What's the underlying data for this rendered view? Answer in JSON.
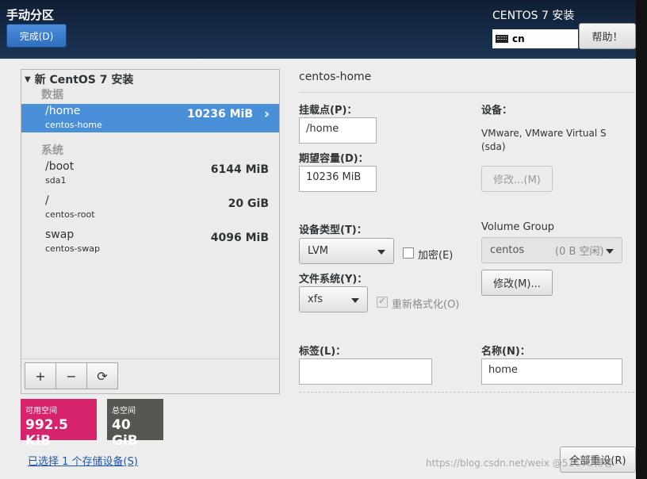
{
  "header": {
    "title": "手动分区",
    "done_label": "完成(D)",
    "product": "CENTOS 7 安装",
    "keyboard_layout": "cn",
    "help_label": "帮助！"
  },
  "tree": {
    "root_label": "新 CentOS 7 安装",
    "sections": [
      {
        "label": "数据",
        "items": [
          {
            "name": "/home",
            "device": "centos-home",
            "size": "10236 MiB",
            "selected": true
          }
        ]
      },
      {
        "label": "系统",
        "items": [
          {
            "name": "/boot",
            "device": "sda1",
            "size": "6144 MiB"
          },
          {
            "name": "/",
            "device": "centos-root",
            "size": "20 GiB"
          },
          {
            "name": "swap",
            "device": "centos-swap",
            "size": "4096 MiB"
          }
        ]
      }
    ],
    "toolbar": {
      "add": "+",
      "remove": "−",
      "refresh": "⟳"
    }
  },
  "space": {
    "available_label": "可用空间",
    "available_value": "992.5 KiB",
    "total_label": "总空间",
    "total_value": "40 GiB"
  },
  "storage_link": "已选择 1 个存储设备(S)",
  "detail": {
    "title": "centos-home",
    "mount_label": "挂载点(P)：",
    "mount_value": "/home",
    "capacity_label": "期望容量(D)：",
    "capacity_value": "10236 MiB",
    "device_label": "设备：",
    "device_info": "VMware, VMware Virtual S (sda)",
    "modify_device_label": "修改...(M)",
    "device_type_label": "设备类型(T)：",
    "device_type_value": "LVM",
    "encrypt_label": "加密(E)",
    "vg_label": "Volume Group",
    "vg_name": "centos",
    "vg_free": "(0 B 空闲)",
    "fs_label": "文件系统(Y)：",
    "fs_value": "xfs",
    "reformat_label": "重新格式化(O)",
    "modify_vg_label": "修改(M)...",
    "tag_label": "标签(L)：",
    "tag_value": "",
    "name_label": "名称(N)：",
    "name_value": "home",
    "reset_label": "全部重设(R)"
  },
  "watermark": "https://blog.csdn.net/weix @51CTO博客"
}
